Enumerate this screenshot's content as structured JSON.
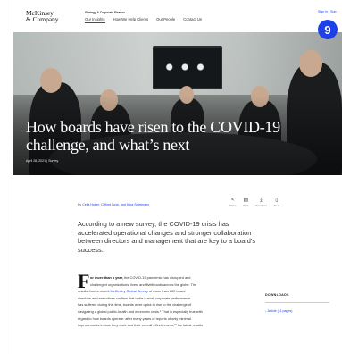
{
  "header": {
    "logo_line1": "McKinsey",
    "logo_line2": "& Company",
    "eyebrow": "Strategy & Corporate Finance",
    "nav": [
      "Our Insights",
      "How We Help Clients",
      "Our People",
      "Contact Us"
    ],
    "sign_in": "Sign In | Sub"
  },
  "badge": {
    "count": "9"
  },
  "hero": {
    "title": "How boards have risen to the COVID-19 challenge, and what’s next",
    "meta": "April 28, 2021 | Survey"
  },
  "byline": {
    "prefix": "By",
    "authors": "Celia Huber, Clifford Lusk, and Nina Spielmann"
  },
  "share": [
    {
      "icon": "share-icon",
      "glyph": "<",
      "label": "Share"
    },
    {
      "icon": "print-icon",
      "glyph": "▤",
      "label": "Print"
    },
    {
      "icon": "download-icon",
      "glyph": "⤓",
      "label": "Download"
    },
    {
      "icon": "save-icon",
      "glyph": "▯",
      "label": "Save"
    }
  ],
  "summary": "According to a new survey, the COVID-19 crisis has accelerated operational changes and stronger collaboration between directors and management that are key to a board’s success.",
  "body": {
    "dropcap": "F",
    "line1_bold": "or more than a year,",
    "line1_rest": " the COVID-19 pandemic has disrupted and",
    "line2": "challenged organizations, lives, and livelihoods across the globe. The",
    "line3_pre": "results from a recent ",
    "line3_link": "McKinsey Global Survey",
    "line3_post": " of more than 800 board",
    "line4": "directors and executives confirm that while overall corporate performance",
    "line5": "has suffered during this time, boards were quick to rise to the challenge of",
    "line6": "navigating a global public-health and economic crisis.¹ That is especially true with",
    "line7": "regard to how boards operate: after many years of reports of only minimal",
    "line8": "improvements in how they work and their overall effectiveness,²³ the latest results"
  },
  "downloads": {
    "heading": "DOWNLOADS",
    "item": "↓ Article (11 pages)"
  },
  "colors": {
    "accent": "#1f40e6"
  }
}
